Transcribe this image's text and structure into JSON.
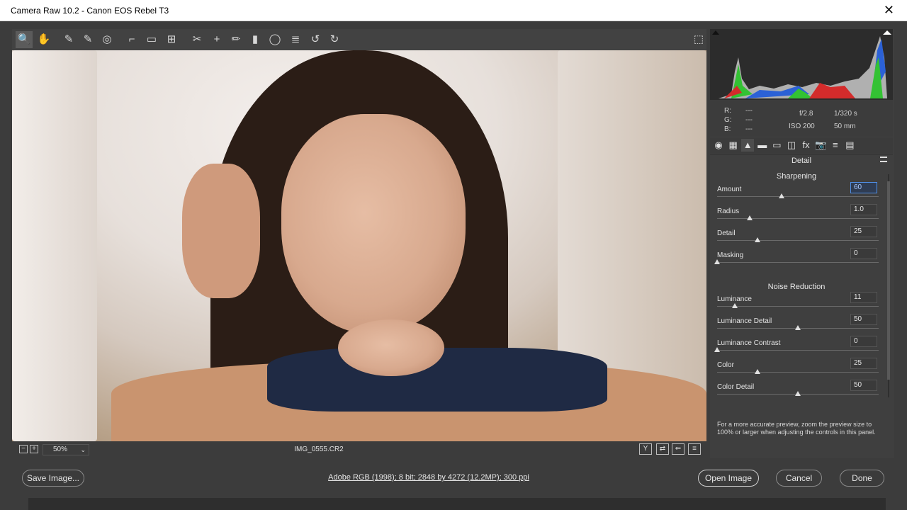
{
  "window": {
    "title": "Camera Raw 10.2  -  Canon EOS Rebel T3",
    "close_glyph": "✕"
  },
  "toolbar": {
    "tools": [
      {
        "name": "zoom-tool-icon",
        "glyph": "🔍"
      },
      {
        "name": "hand-tool-icon",
        "glyph": "✋"
      },
      {
        "name": "white-balance-tool-icon",
        "glyph": "✎"
      },
      {
        "name": "color-sampler-tool-icon",
        "glyph": "✎"
      },
      {
        "name": "targeted-adjustment-tool-icon",
        "glyph": "◎"
      },
      {
        "name": "crop-tool-icon",
        "glyph": "⌐"
      },
      {
        "name": "straighten-tool-icon",
        "glyph": "▭"
      },
      {
        "name": "transform-tool-icon",
        "glyph": "⊞"
      },
      {
        "name": "spot-removal-tool-icon",
        "glyph": "✂"
      },
      {
        "name": "red-eye-removal-icon",
        "glyph": "+"
      },
      {
        "name": "adjustment-brush-icon",
        "glyph": "✏"
      },
      {
        "name": "graduated-filter-icon",
        "glyph": "▮"
      },
      {
        "name": "radial-filter-icon",
        "glyph": "◯"
      },
      {
        "name": "preferences-icon",
        "glyph": "≣"
      },
      {
        "name": "rotate-ccw-icon",
        "glyph": "↺"
      },
      {
        "name": "rotate-cw-icon",
        "glyph": "↻"
      }
    ],
    "fullscreen_glyph": "⬚"
  },
  "preview": {
    "zoom_label": "50%",
    "filename": "IMG_0555.CR2",
    "view_buttons": [
      "Y",
      "⇄",
      "⇐",
      "≡"
    ]
  },
  "histogram": {
    "readout": {
      "r_label": "R:",
      "r_value": "---",
      "g_label": "G:",
      "g_value": "---",
      "b_label": "B:",
      "b_value": "---",
      "aperture": "f/2.8",
      "shutter": "1/320 s",
      "iso": "ISO 200",
      "focal": "50 mm"
    }
  },
  "panel": {
    "title": "Detail",
    "tabs": [
      "◉",
      "▦",
      "▲",
      "▬",
      "▭",
      "◫",
      "fx",
      "📷",
      "≡",
      "▤"
    ],
    "sharpening": {
      "title": "Sharpening",
      "rows": [
        {
          "label": "Amount",
          "value": "60",
          "level": 0.4
        },
        {
          "label": "Radius",
          "value": "1.0",
          "level": 0.2
        },
        {
          "label": "Detail",
          "value": "25",
          "level": 0.25
        },
        {
          "label": "Masking",
          "value": "0",
          "level": 0.0
        }
      ]
    },
    "noise": {
      "title": "Noise Reduction",
      "rows": [
        {
          "label": "Luminance",
          "value": "11",
          "level": 0.11
        },
        {
          "label": "Luminance Detail",
          "value": "50",
          "level": 0.5
        },
        {
          "label": "Luminance Contrast",
          "value": "0",
          "level": 0.0
        },
        {
          "label": "Color",
          "value": "25",
          "level": 0.25
        },
        {
          "label": "Color Detail",
          "value": "50",
          "level": 0.5
        }
      ]
    },
    "hint": "For a more accurate preview, zoom the preview size to 100% or larger when adjusting the controls in this panel."
  },
  "bottom": {
    "save_label": "Save Image...",
    "info_link": "Adobe RGB (1998); 8 bit; 2848 by 4272 (12.2MP); 300 ppi",
    "open_label": "Open Image",
    "cancel_label": "Cancel",
    "done_label": "Done"
  }
}
